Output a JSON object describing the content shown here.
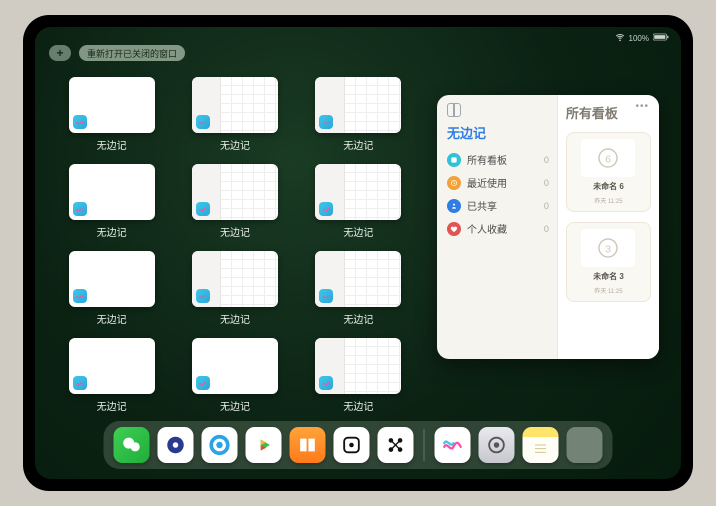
{
  "status": {
    "time_label": "",
    "battery_text": "100%"
  },
  "topbar": {
    "add_symbol": "+",
    "reopen_label": "重新打开已关闭的窗口"
  },
  "app_tile_label": "无边记",
  "tiles": [
    {
      "type": "blank"
    },
    {
      "type": "calendar"
    },
    {
      "type": "calendar"
    },
    {
      "type": "blank"
    },
    {
      "type": "calendar"
    },
    {
      "type": "calendar"
    },
    {
      "type": "blank"
    },
    {
      "type": "calendar"
    },
    {
      "type": "calendar"
    },
    {
      "type": "blank"
    },
    {
      "type": "blank"
    },
    {
      "type": "calendar"
    }
  ],
  "panel": {
    "left_title": "无边记",
    "right_title": "所有看板",
    "nav": [
      {
        "label": "所有看板",
        "count": 0,
        "color": "c-cyan"
      },
      {
        "label": "最近使用",
        "count": 0,
        "color": "c-orange"
      },
      {
        "label": "已共享",
        "count": 0,
        "color": "c-blue"
      },
      {
        "label": "个人收藏",
        "count": 0,
        "color": "c-red"
      }
    ],
    "boards": [
      {
        "name": "未命名 6",
        "sub": "昨天 11:25",
        "digit": "6"
      },
      {
        "name": "未命名 3",
        "sub": "昨天 11:25",
        "digit": "3"
      }
    ],
    "dots": "•••"
  },
  "dock": {
    "apps": [
      {
        "name": "wechat",
        "bg": "linear-gradient(135deg,#3fcf54,#1fae39)"
      },
      {
        "name": "browser1",
        "bg": "#ffffff"
      },
      {
        "name": "browser2",
        "bg": "#ffffff"
      },
      {
        "name": "play",
        "bg": "#ffffff"
      },
      {
        "name": "books",
        "bg": "linear-gradient(180deg,#ffa33a,#ff7a1a)"
      },
      {
        "name": "dice",
        "bg": "#ffffff"
      },
      {
        "name": "graph",
        "bg": "#ffffff"
      }
    ],
    "recent": [
      {
        "name": "freeform",
        "bg": "#ffffff"
      },
      {
        "name": "settings",
        "bg": "linear-gradient(180deg,#e9e9ee,#c7c7cf)"
      },
      {
        "name": "notes",
        "bg": "linear-gradient(180deg,#ffe46b 0 28%,#fffef6 28% 100%)"
      },
      {
        "name": "folder",
        "bg": ""
      }
    ]
  }
}
